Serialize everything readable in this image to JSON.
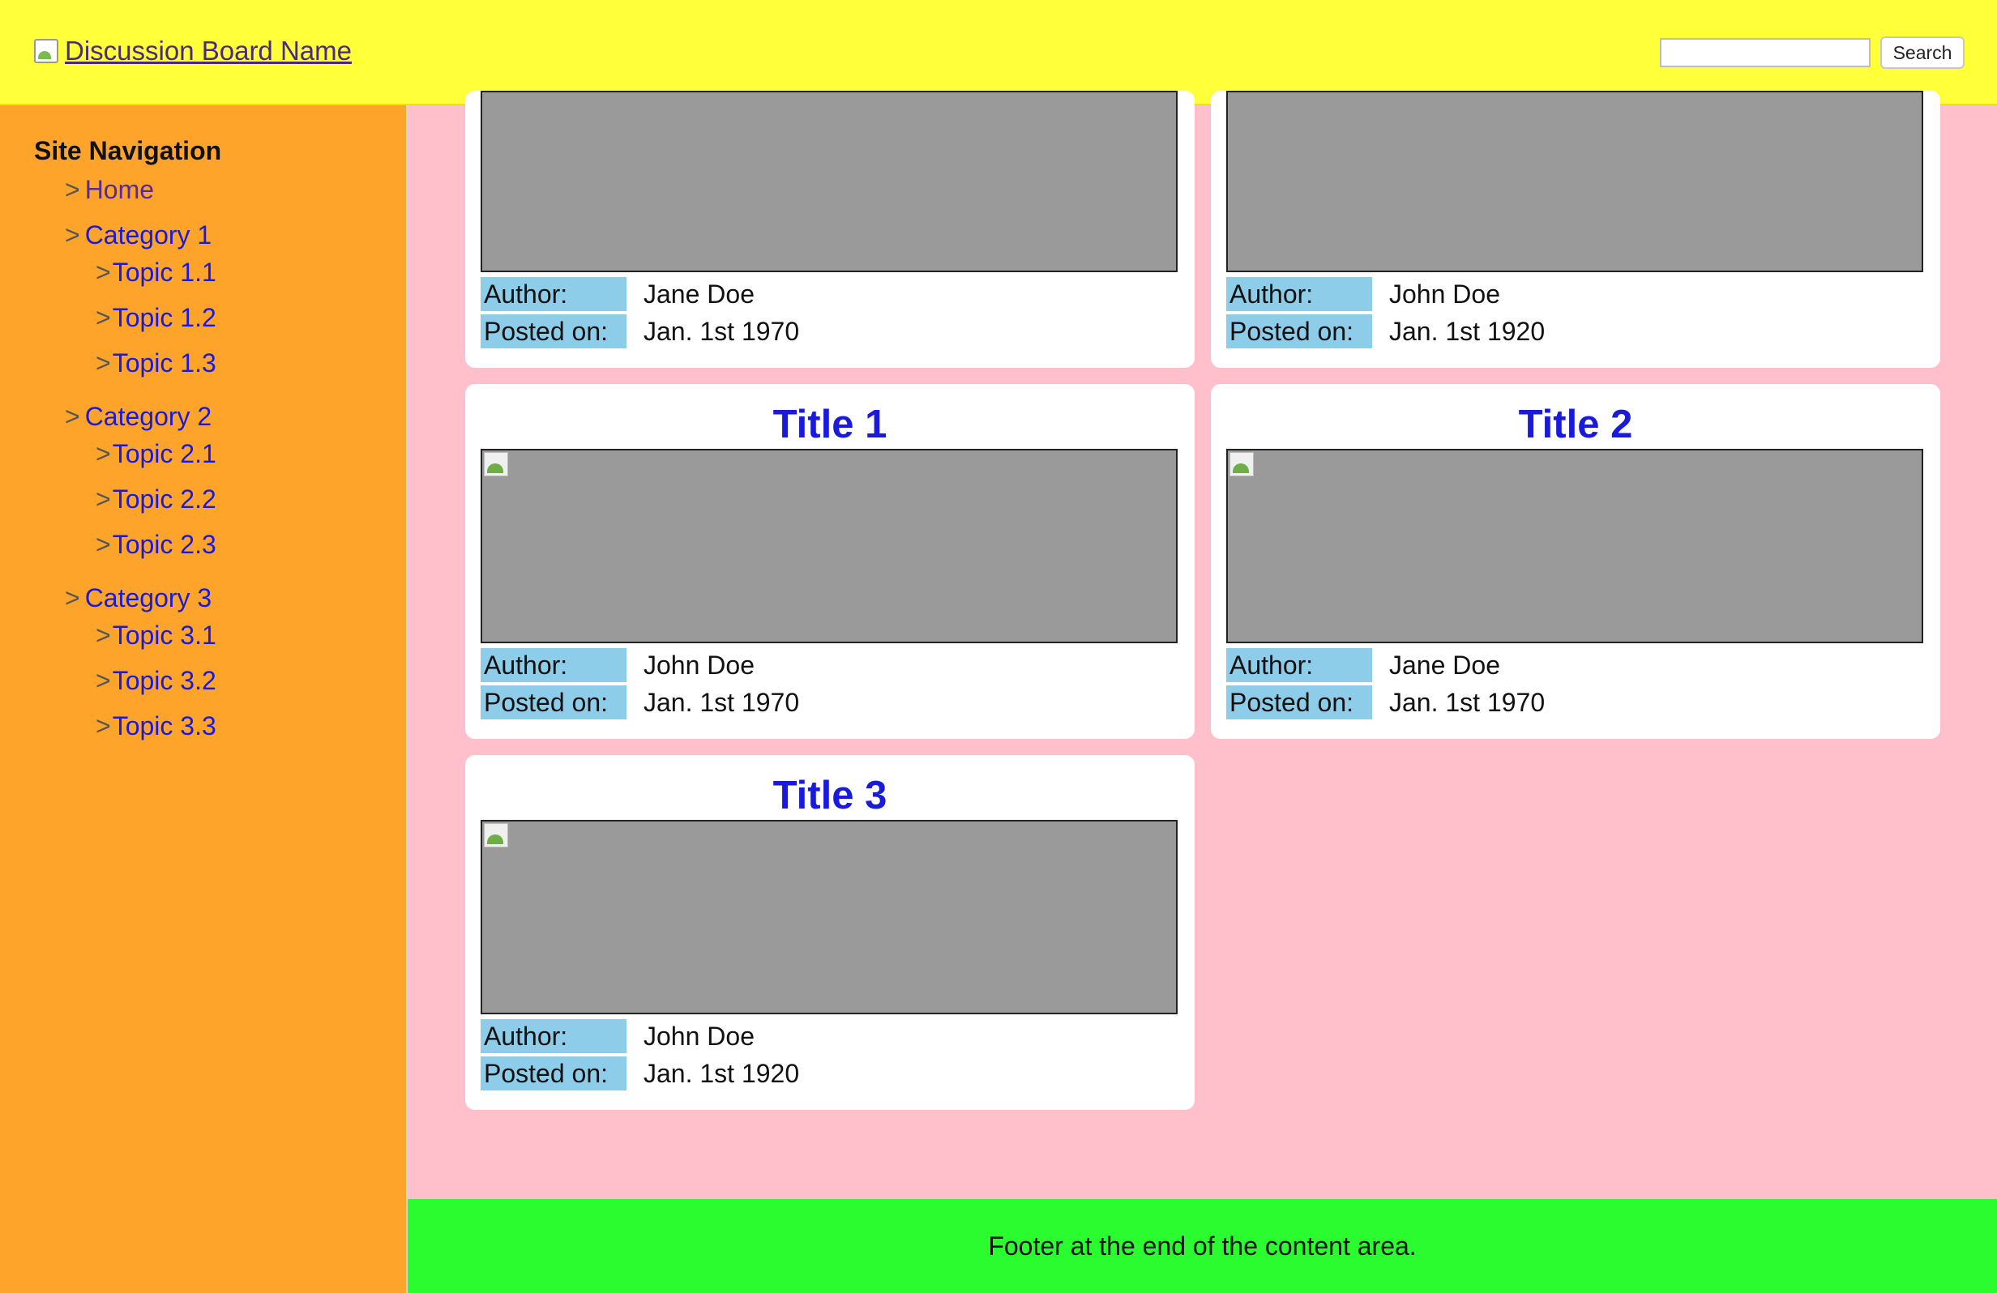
{
  "header": {
    "brand_label": "Discussion Board Name",
    "search_placeholder": "",
    "search_label": "Search"
  },
  "sidebar": {
    "title": "Site Navigation",
    "arrow": ">",
    "home_label": "Home",
    "categories": [
      {
        "label": "Category 1",
        "topics": [
          "Topic 1.1",
          "Topic 1.2",
          "Topic 1.3"
        ]
      },
      {
        "label": "Category 2",
        "topics": [
          "Topic 2.1",
          "Topic 2.2",
          "Topic 2.3"
        ]
      },
      {
        "label": "Category 3",
        "topics": [
          "Topic 3.1",
          "Topic 3.2",
          "Topic 3.3"
        ]
      }
    ]
  },
  "meta_labels": {
    "author": "Author:",
    "posted": "Posted on:"
  },
  "posts": [
    {
      "title": "",
      "author": "Jane Doe",
      "posted": "Jan. 1st 1970"
    },
    {
      "title": "",
      "author": "John Doe",
      "posted": "Jan. 1st 1920"
    },
    {
      "title": "Title 1",
      "author": "John Doe",
      "posted": "Jan. 1st 1970"
    },
    {
      "title": "Title 2",
      "author": "Jane Doe",
      "posted": "Jan. 1st 1970"
    },
    {
      "title": "Title 3",
      "author": "John Doe",
      "posted": "Jan. 1st 1920"
    }
  ],
  "footer": {
    "text": "Footer at the end of the content area."
  }
}
